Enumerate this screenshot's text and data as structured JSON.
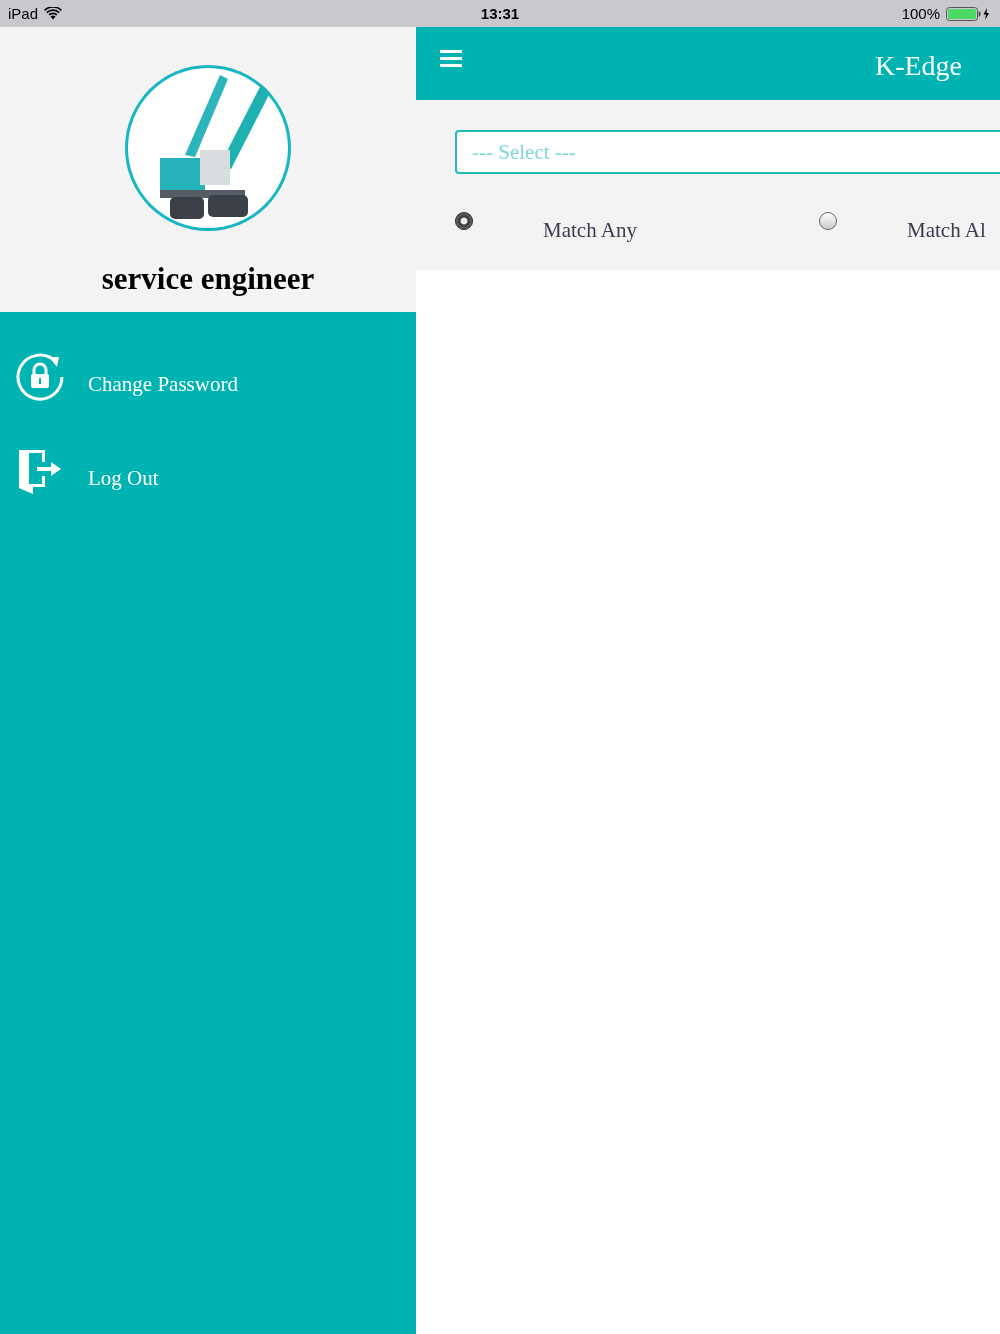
{
  "status_bar": {
    "carrier": "iPad",
    "time": "13:31",
    "battery": "100%"
  },
  "sidebar": {
    "user_name": "service engineer",
    "items": [
      {
        "kind": "password",
        "label": "Change Password"
      },
      {
        "kind": "logout",
        "label": "Log Out"
      }
    ]
  },
  "header": {
    "title": "K-Edge"
  },
  "select": {
    "placeholder": "--- Select ---"
  },
  "match_options": [
    {
      "label": "Match Any",
      "selected": true
    },
    {
      "label": "Match Al",
      "selected": false
    }
  ]
}
